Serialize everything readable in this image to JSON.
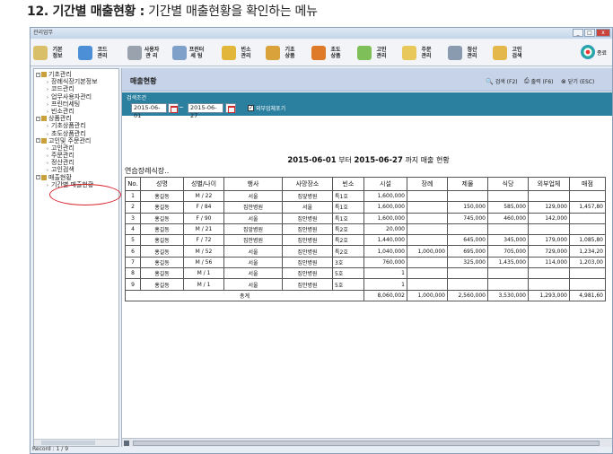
{
  "caption": {
    "main": "12. 기간별 매출현황 :",
    "sub": " 기간별 매출현황을 확인하는 메뉴"
  },
  "window": {
    "title": "관리업무",
    "btn_min": "_",
    "btn_max": "□",
    "btn_close": "x"
  },
  "toolbar": [
    {
      "label": "기본\n정보",
      "icon": "id-card-icon",
      "color": "#d9bf6a"
    },
    {
      "label": "코드\n관리",
      "icon": "people-icon",
      "color": "#4c8fd6"
    },
    {
      "label": "사용자\n관 리",
      "icon": "gear-icon",
      "color": "#9aa3ad"
    },
    {
      "label": "프린터\n세 팅",
      "icon": "printer-icon",
      "color": "#7fa0c8"
    },
    {
      "label": "빈소\n관리",
      "icon": "flower-icon",
      "color": "#e2b63b"
    },
    {
      "label": "기초\n상품",
      "icon": "box-icon",
      "color": "#d9a23b"
    },
    {
      "label": "초도\n상품",
      "icon": "bag-icon",
      "color": "#e07a2b"
    },
    {
      "label": "고인\n관리",
      "icon": "person-icon",
      "color": "#7fbf5a"
    },
    {
      "label": "주문\n관리",
      "icon": "pencil-icon",
      "color": "#e8c85a"
    },
    {
      "label": "정산\n관리",
      "icon": "calculator-icon",
      "color": "#8a9bb0"
    },
    {
      "label": "고인\n검색",
      "icon": "search-person-icon",
      "color": "#e4b84a"
    }
  ],
  "exit_label": "종료",
  "sidebar": {
    "items": [
      {
        "label": "기초관리",
        "level": 0
      },
      {
        "label": "장례식장기본정보",
        "level": 1
      },
      {
        "label": "코드관리",
        "level": 1
      },
      {
        "label": "업무사용자관리",
        "level": 1
      },
      {
        "label": "프린터세팅",
        "level": 1
      },
      {
        "label": "빈소관리",
        "level": 1
      },
      {
        "label": "상품관리",
        "level": 0
      },
      {
        "label": "기초상품관리",
        "level": 1
      },
      {
        "label": "초도상품관리",
        "level": 1
      },
      {
        "label": "고인및 주문관리",
        "level": 0
      },
      {
        "label": "고인관리",
        "level": 1
      },
      {
        "label": "주문관리",
        "level": 1
      },
      {
        "label": "정산관리",
        "level": 1
      },
      {
        "label": "고인검색",
        "level": 1
      },
      {
        "label": "매출현황",
        "level": 0
      },
      {
        "label": "기간별 매출현황",
        "level": 1
      }
    ],
    "status": "Record : 1 / 9"
  },
  "content": {
    "title": "매출현황",
    "btn_search": "검색 (F2)",
    "btn_print": "출력 (F6)",
    "btn_close": "닫기 (ESC)",
    "cond_label": "검색조건",
    "date_from": "2015-06-01",
    "date_to": "2015-06-27",
    "tilde": "~",
    "chk_label": "외부업체포기",
    "chk_mark": "✓"
  },
  "report": {
    "title_from": "2015-06-01",
    "title_mid": "부터",
    "title_to": "2015-06-27",
    "title_tail": "까지 매출 현황",
    "store": "연습장례식장..",
    "headers": [
      "No.",
      "성명",
      "성별/나이",
      "행사",
      "사망장소",
      "빈소",
      "시설",
      "장례",
      "제물",
      "식당",
      "외부업체",
      "매점"
    ],
    "rows": [
      [
        "1",
        "홍길동",
        "M / 22",
        "서울",
        "집앞병원",
        "특1호",
        "1,600,000",
        "",
        "",
        "",
        "",
        ""
      ],
      [
        "2",
        "홍길동",
        "F / 84",
        "집안병원",
        "서울",
        "특1호",
        "1,600,000",
        "",
        "150,000",
        "585,000",
        "129,000",
        "1,457,80"
      ],
      [
        "3",
        "홍길동",
        "F / 90",
        "서울",
        "집안병원",
        "특1호",
        "1,600,000",
        "",
        "745,000",
        "460,000",
        "142,000",
        ""
      ],
      [
        "4",
        "홍길동",
        "M / 21",
        "집앞병원",
        "집안병원",
        "특2호",
        "20,000",
        "",
        "",
        "",
        "",
        ""
      ],
      [
        "5",
        "홍길동",
        "F / 72",
        "집안병원",
        "집안병원",
        "특2호",
        "1,440,000",
        "",
        "645,000",
        "345,000",
        "179,000",
        "1,085,80"
      ],
      [
        "6",
        "홍길동",
        "M / 52",
        "서울",
        "집안병원",
        "특2호",
        "1,040,000",
        "1,000,000",
        "695,000",
        "705,000",
        "729,000",
        "1,234,20"
      ],
      [
        "7",
        "홍길동",
        "M / 56",
        "서울",
        "집안병원",
        "3호",
        "760,000",
        "",
        "325,000",
        "1,435,000",
        "114,000",
        "1,203,00"
      ],
      [
        "8",
        "홍길동",
        "M / 1",
        "서울",
        "집안병원",
        "5호",
        "1",
        "",
        "",
        "",
        "",
        ""
      ],
      [
        "9",
        "홍길동",
        "M / 1",
        "서울",
        "집안병원",
        "5호",
        "1",
        "",
        "",
        "",
        "",
        ""
      ]
    ],
    "total_label": "총계",
    "totals": [
      "8,060,002",
      "1,000,000",
      "2,560,000",
      "3,530,000",
      "1,293,000",
      "4,981,60"
    ]
  }
}
